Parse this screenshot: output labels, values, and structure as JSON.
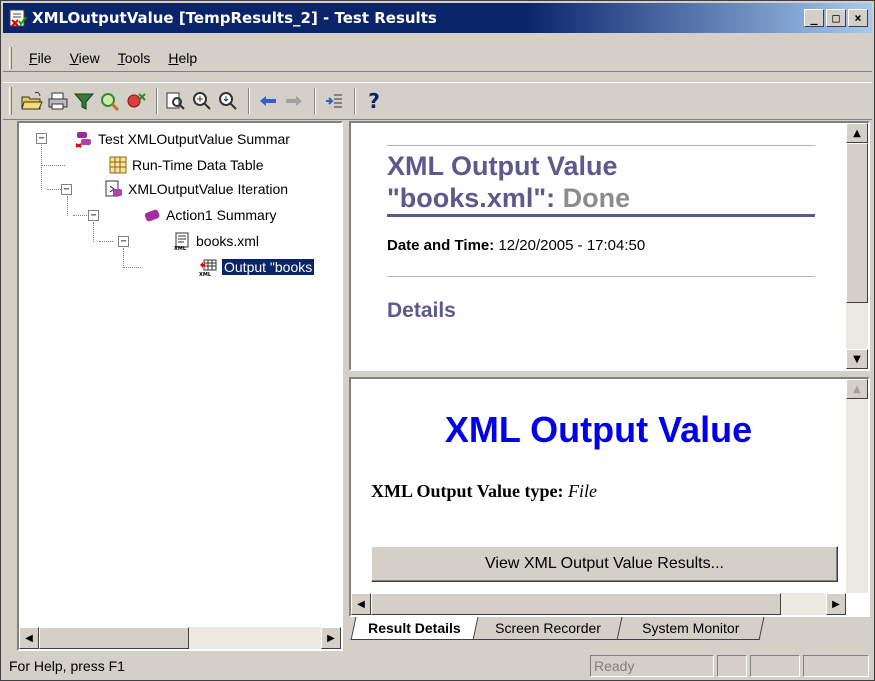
{
  "window": {
    "title": "XMLOutputValue [TempResults_2] - Test Results",
    "controls": [
      "_",
      "□",
      "×"
    ]
  },
  "menu": [
    {
      "label": "File",
      "u": "F",
      "rest": "ile"
    },
    {
      "label": "View",
      "u": "V",
      "rest": "iew"
    },
    {
      "label": "Tools",
      "u": "T",
      "rest": "ools"
    },
    {
      "label": "Help",
      "u": "H",
      "rest": "elp"
    }
  ],
  "toolbar": {
    "icons": [
      "open-icon",
      "print-icon",
      "filter-icon",
      "find-icon",
      "delete-icon",
      "preview-icon",
      "zoom-in-icon",
      "zoom-out-icon",
      "back-icon",
      "forward-icon",
      "expand-icon",
      "help-icon"
    ]
  },
  "tree": {
    "root": "Test XMLOutputValue Summar",
    "runtime_table": "Run-Time Data Table",
    "iteration": "XMLOutputValue Iteration",
    "action": "Action1 Summary",
    "file": "books.xml",
    "output": "Output \"books"
  },
  "summary": {
    "title_line1": "XML Output Value",
    "title_line2_prefix": "\"books.xml\": ",
    "title_status": "Done",
    "date_label": "Date and Time:",
    "date_value": "12/20/2005 - 17:04:50",
    "details": "Details"
  },
  "detail": {
    "heading": "XML Output Value",
    "type_label": "XML Output Value type:",
    "type_value": "File",
    "results_button": "View XML Output Value Results..."
  },
  "tabs": [
    "Result Details",
    "Screen Recorder",
    "System Monitor"
  ],
  "status": {
    "help_text": "For Help, press F1",
    "ready": "Ready"
  },
  "colors": {
    "titlebar": "#0a246a",
    "summary_accent": "#5a5a8c",
    "heading_blue": "#0000ee"
  }
}
